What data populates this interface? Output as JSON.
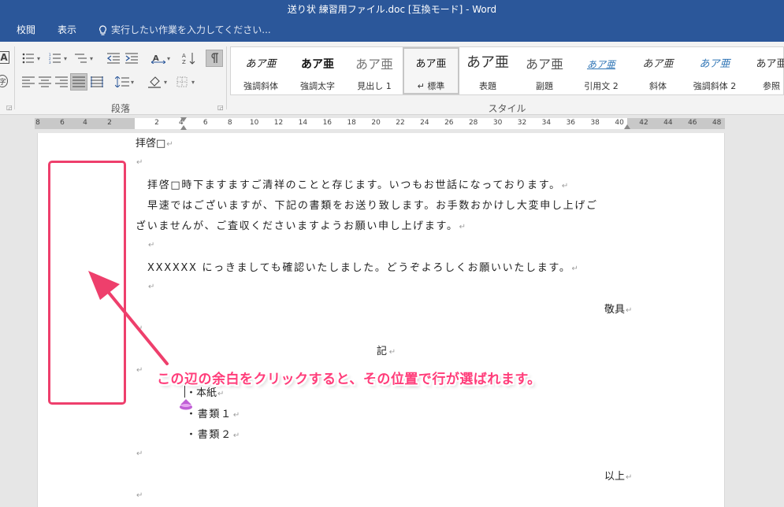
{
  "window": {
    "title": "送り状  練習用ファイル.doc [互換モード] - Word"
  },
  "tabs": [
    {
      "label": "校閲"
    },
    {
      "label": "表示"
    }
  ],
  "tell_me": {
    "placeholder": "実行したい作業を入力してください..."
  },
  "ribbon": {
    "paragraph_group_label": "段落",
    "styles_group_label": "スタイル",
    "left_edge_glyphs": [
      "A",
      "字"
    ],
    "styles": [
      {
        "name": "強調斜体",
        "preview": "あア亜"
      },
      {
        "name": "強調太字",
        "preview": "あア亜"
      },
      {
        "name": "見出し 1",
        "preview": "あア亜"
      },
      {
        "name": "↵ 標準",
        "preview": "あア亜",
        "selected": true
      },
      {
        "name": "表題",
        "preview": "あア亜"
      },
      {
        "name": "副題",
        "preview": "あア亜"
      },
      {
        "name": "引用文 2",
        "preview": "あア亜"
      },
      {
        "name": "斜体",
        "preview": "あア亜"
      },
      {
        "name": "強調斜体 2",
        "preview": "あア亜"
      },
      {
        "name": "参照",
        "preview": "あア亜"
      }
    ]
  },
  "ruler": {
    "numbers": [
      "8",
      "6",
      "4",
      "2",
      "2",
      "4",
      "6",
      "8",
      "10",
      "12",
      "14",
      "16",
      "18",
      "20",
      "22",
      "24",
      "26",
      "28",
      "30",
      "32",
      "34",
      "36",
      "38",
      "40",
      "42",
      "44",
      "46",
      "48"
    ]
  },
  "document": {
    "lines": [
      {
        "text": "拝啓□",
        "pm": "↵"
      },
      {
        "text": "",
        "pm": "↵"
      },
      {
        "text": "拝啓□時下ますますご清祥のことと存じます。いつもお世話になっております。",
        "pm": "↵"
      },
      {
        "text": "早速ではございますが、下記の書類をお送り致します。お手数おかけし大変申し上げご",
        "pm": ""
      },
      {
        "text": "ざいませんが、ご査収くださいますようお願い申し上げます。",
        "pm": "↵"
      },
      {
        "text": "",
        "pm": "↵"
      },
      {
        "text": "XXXXXX にっきましても確認いたしました。どうぞよろしくお願いいたします。",
        "pm": "↵"
      },
      {
        "text": "",
        "pm": "↵"
      },
      {
        "text": "敬具",
        "pm": "↵"
      },
      {
        "text": "",
        "pm": "↵"
      },
      {
        "text": "記",
        "pm": "↵"
      },
      {
        "text": "",
        "pm": "↵"
      },
      {
        "text": "・本紙",
        "pm": "↵"
      },
      {
        "text": "・書類１",
        "pm": "↵"
      },
      {
        "text": "・書類２",
        "pm": "↵"
      },
      {
        "text": "",
        "pm": "↵"
      },
      {
        "text": "以上",
        "pm": "↵"
      },
      {
        "text": "",
        "pm": "↵"
      }
    ]
  },
  "annotation": {
    "text": "この辺の余白をクリックすると、その位置で行が選ばれます。",
    "color": "#ff3d7a"
  },
  "colors": {
    "brand": "#2b579a",
    "callout": "#ee3f6c"
  }
}
